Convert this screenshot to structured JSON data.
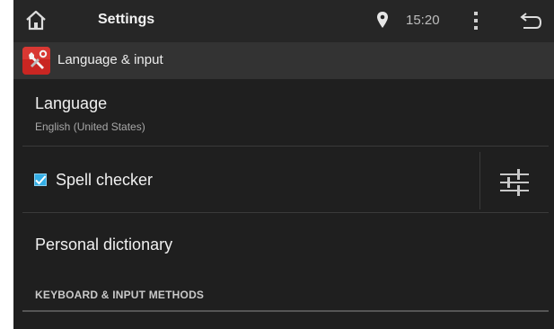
{
  "status_bar": {
    "title": "Settings",
    "time": "15:20",
    "icons": [
      "home-icon",
      "location-pin-icon",
      "overflow-menu-icon",
      "back-icon"
    ]
  },
  "action_bar": {
    "title": "Language & input",
    "icon": "settings-wrench-icon",
    "up_icon": "chevron-left-icon"
  },
  "list": {
    "language": {
      "title": "Language",
      "summary": "English (United States)"
    },
    "spell_checker": {
      "title": "Spell checker",
      "checked": true,
      "settings_icon": "sliders-icon"
    },
    "personal_dictionary": {
      "title": "Personal dictionary"
    },
    "section_keyboard": {
      "header": "KEYBOARD & INPUT METHODS"
    }
  },
  "colors": {
    "accent": "#33aee6",
    "app_icon_red": "#cf2a27"
  }
}
